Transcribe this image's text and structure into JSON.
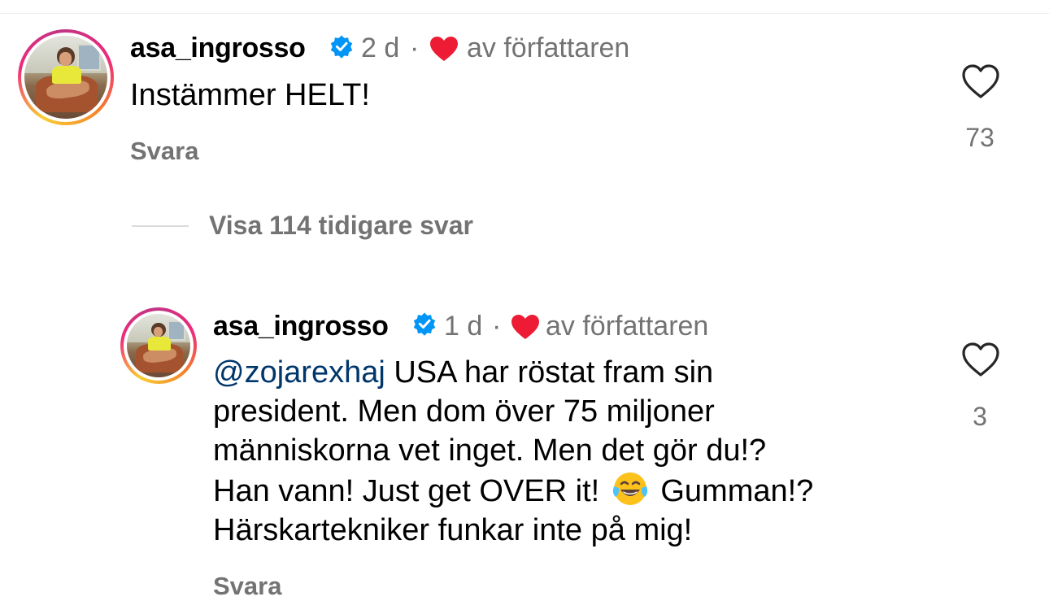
{
  "colors": {
    "text": "#000000",
    "secondary": "#737373",
    "mention": "#00376b",
    "verified": "#0095f6",
    "heart_red": "#ed1c34",
    "divider": "#dbdbdb"
  },
  "comments": [
    {
      "username": "asa_ingrosso",
      "verified": true,
      "time": "2 d",
      "separator": "·",
      "liked_by_author": "av författaren",
      "text": "Instämmer HELT!",
      "reply_label": "Svara",
      "like_count": "73"
    },
    {
      "username": "asa_ingrosso",
      "verified": true,
      "time": "1 d",
      "separator": "·",
      "liked_by_author": "av författaren",
      "mention": "@zojarexhaj",
      "line1_rest": " USA har röstat fram sin",
      "line2": "president. Men dom över 75 miljoner",
      "line3": "människorna vet inget. Men det gör du!?",
      "line4_a": "Han vann! Just get OVER it!",
      "line4_emoji": "face-with-tears-of-joy",
      "line4_b": " Gumman!?",
      "line5": "Härskartekniker funkar inte på mig!",
      "reply_label": "Svara",
      "like_count": "3"
    }
  ],
  "view_previous_replies": "Visa 114 tidigare svar",
  "icons": {
    "verified": "verified-badge-icon",
    "author_heart": "red-heart-icon",
    "like": "heart-outline-icon",
    "emoji": "face-with-tears-of-joy-icon"
  }
}
